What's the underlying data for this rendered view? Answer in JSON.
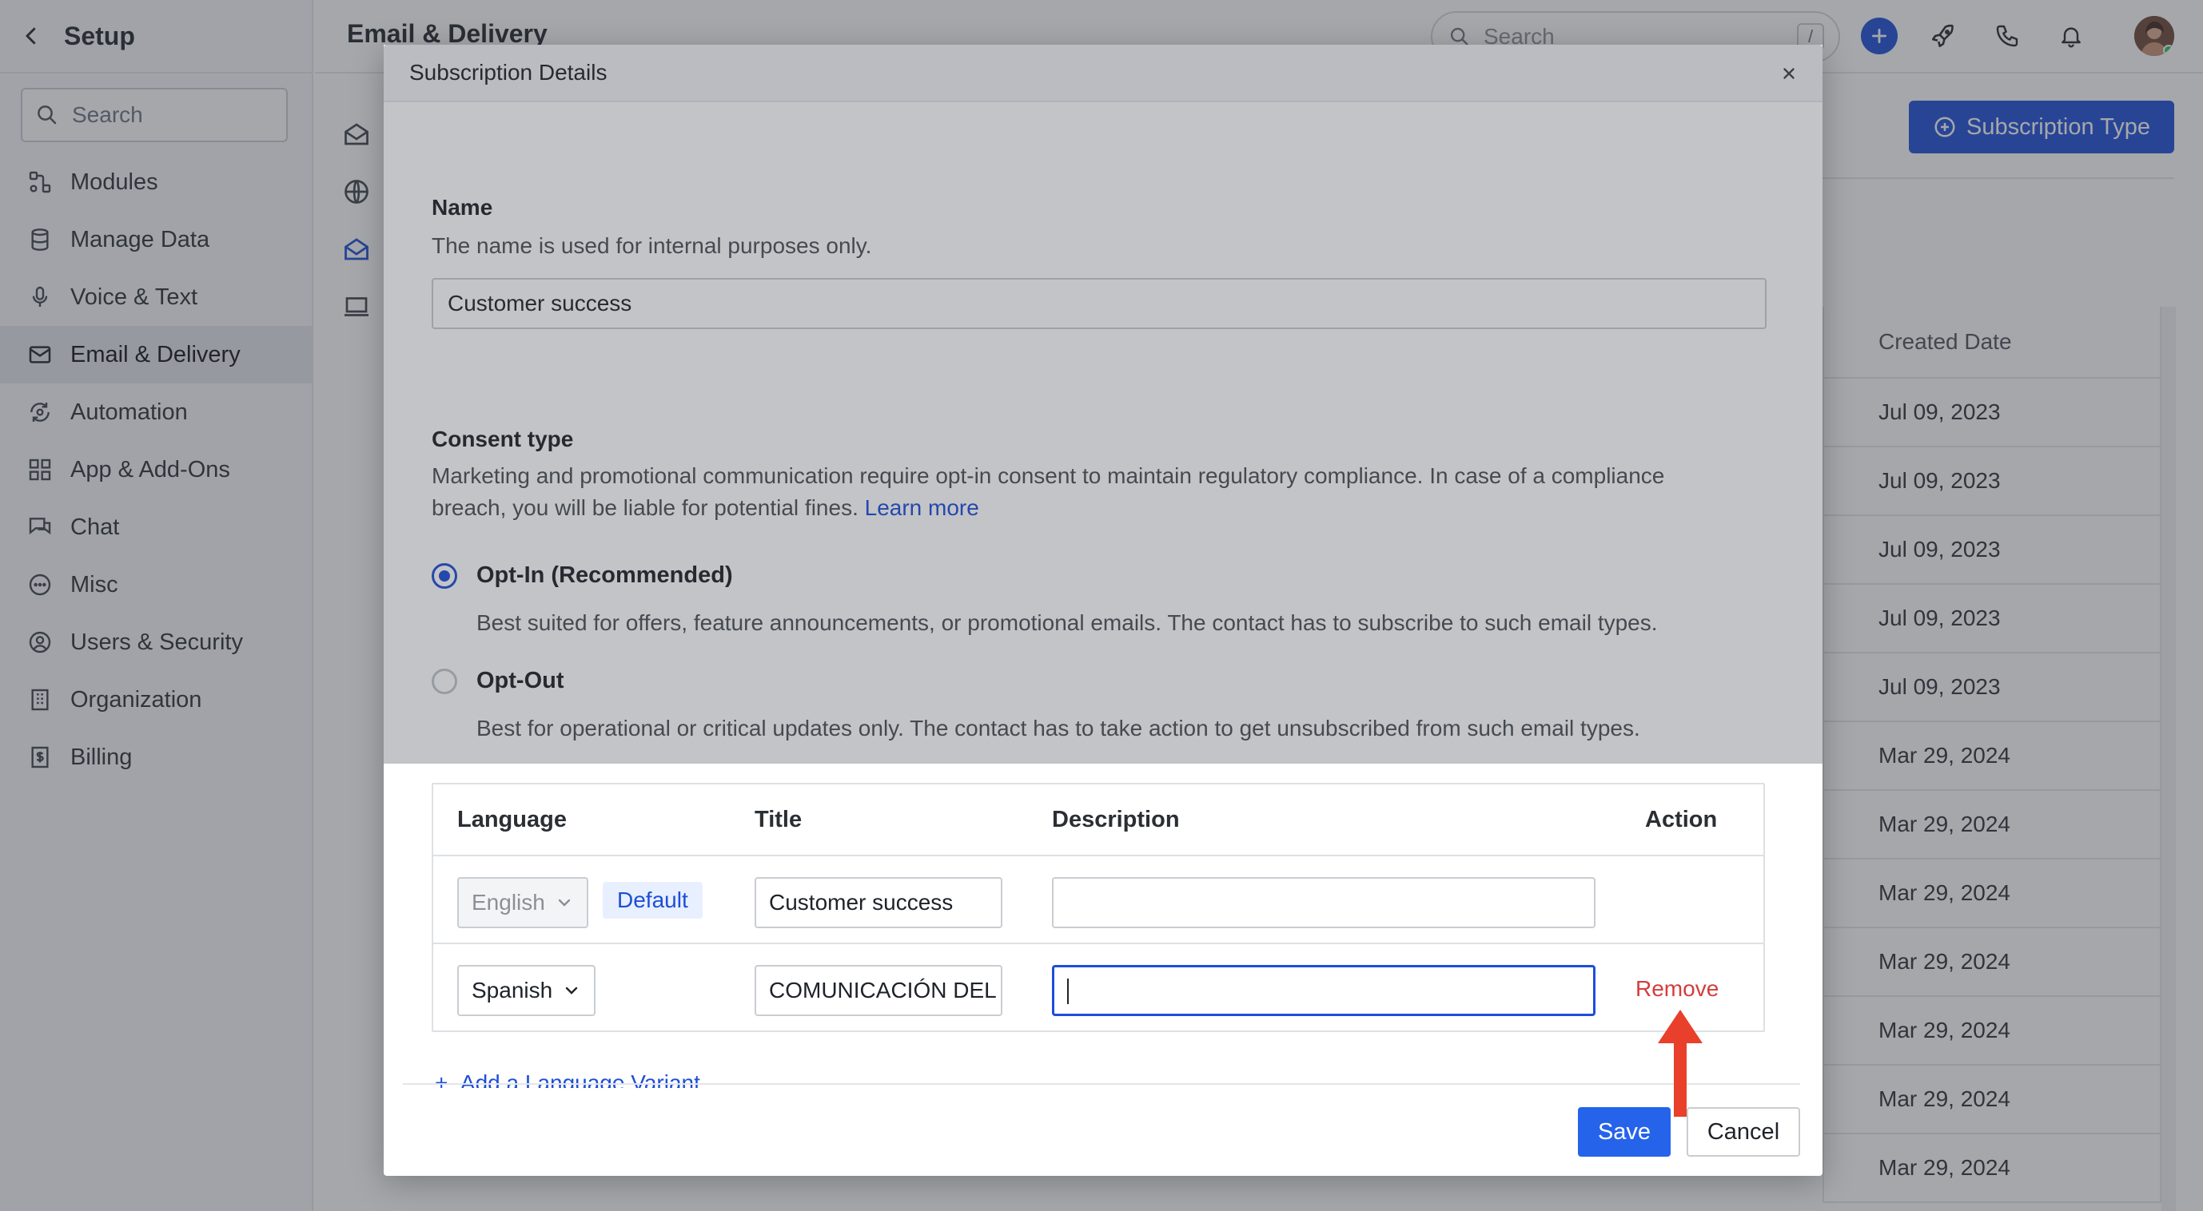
{
  "sidebar": {
    "title": "Setup",
    "search_placeholder": "Search",
    "items": [
      {
        "label": "Modules",
        "icon": "modules-icon"
      },
      {
        "label": "Manage Data",
        "icon": "database-icon"
      },
      {
        "label": "Voice & Text",
        "icon": "microphone-icon"
      },
      {
        "label": "Email & Delivery",
        "icon": "mail-icon",
        "active": true
      },
      {
        "label": "Automation",
        "icon": "automation-icon"
      },
      {
        "label": "App & Add-Ons",
        "icon": "apps-grid-icon"
      },
      {
        "label": "Chat",
        "icon": "chat-icon"
      },
      {
        "label": "Misc",
        "icon": "more-icon"
      },
      {
        "label": "Users & Security",
        "icon": "user-icon"
      },
      {
        "label": "Organization",
        "icon": "building-icon"
      },
      {
        "label": "Billing",
        "icon": "billing-icon"
      }
    ]
  },
  "header": {
    "title": "Email & Delivery",
    "search_placeholder": "Search",
    "search_shortcut": "/"
  },
  "page": {
    "subscription_type_button": "Subscription Type",
    "created_date_header": "Created Date",
    "created_dates": [
      "Jul 09, 2023",
      "Jul 09, 2023",
      "Jul 09, 2023",
      "Jul 09, 2023",
      "Jul 09, 2023",
      "Mar 29, 2024",
      "Mar 29, 2024",
      "Mar 29, 2024",
      "Mar 29, 2024",
      "Mar 29, 2024",
      "Mar 29, 2024",
      "Mar 29, 2024"
    ]
  },
  "modal": {
    "title": "Subscription Details",
    "name_label": "Name",
    "name_help": "The name is used for internal purposes only.",
    "name_value": "Customer success",
    "consent_label": "Consent type",
    "consent_help_1": "Marketing and promotional communication require opt-in consent to maintain regulatory compliance. In case of a compliance",
    "consent_help_2": "breach, you will be liable for potential fines.",
    "learn_more": "Learn more",
    "opt_in_label": "Opt-In (Recommended)",
    "opt_in_desc": "Best suited for offers, feature announcements, or promotional emails. The contact has to subscribe to such email types.",
    "opt_out_label": "Opt-Out",
    "opt_out_desc": "Best for operational or critical updates only. The contact has to take action to get unsubscribed from such email types.",
    "table": {
      "headers": {
        "language": "Language",
        "title": "Title",
        "description": "Description",
        "action": "Action"
      },
      "rows": [
        {
          "language": "English",
          "badge": "Default",
          "title": "Customer success",
          "description": ""
        },
        {
          "language": "Spanish",
          "title": "COMUNICACIÓN DEL",
          "description": "",
          "action": "Remove"
        }
      ]
    },
    "add_variant": "Add a Language Variant",
    "save": "Save",
    "cancel": "Cancel"
  },
  "colors": {
    "accent": "#1d4ed8",
    "danger": "#d43d3d",
    "annotation_arrow": "#e8402a"
  }
}
